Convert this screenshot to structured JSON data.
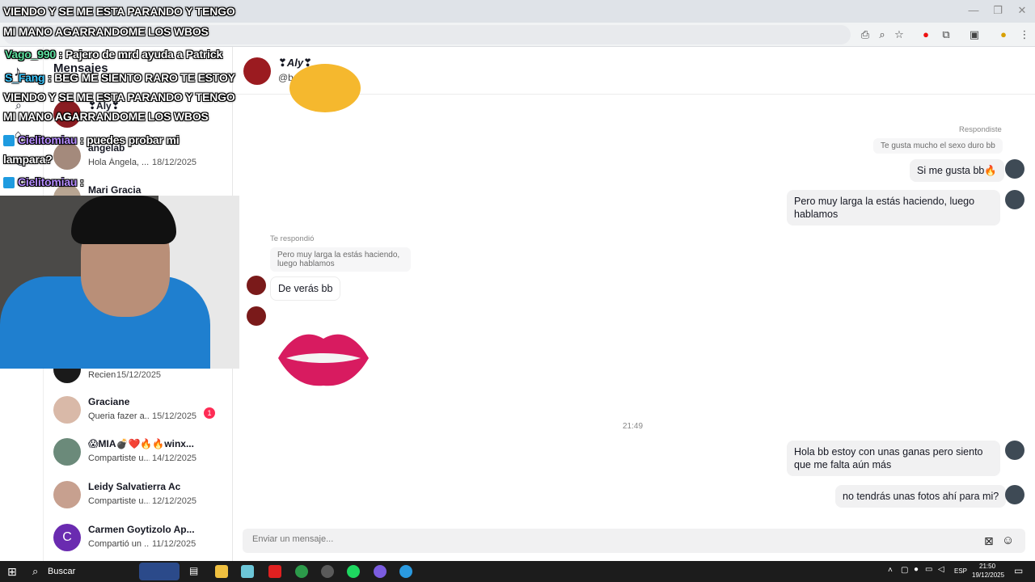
{
  "browser": {
    "window_controls": [
      "—",
      "❐",
      "✕"
    ],
    "toolbar_icons": [
      "install-icon",
      "zoom-icon",
      "star-icon",
      "opera-icon",
      "extensions-icon",
      "tab-icon",
      "profile-icon",
      "menu-icon"
    ]
  },
  "sidebar": {
    "title": "Mensajes"
  },
  "conversations": [
    {
      "name": "❣Aly❣",
      "preview": "",
      "date": ""
    },
    {
      "name": "angelab",
      "preview": "Hola Ángela, ...",
      "date": "18/12/2025"
    },
    {
      "name": "Mari Gracia",
      "preview": "",
      "date": ""
    },
    {
      "name": "",
      "preview": "Recien",
      "date": "15/12/2025"
    },
    {
      "name": "Graciane",
      "preview": "Queria fazer a...",
      "date": "15/12/2025",
      "badge": "1"
    },
    {
      "name": "😱MIA💣❤️🔥🔥winx...",
      "preview": "Compartiste u...",
      "date": "14/12/2025"
    },
    {
      "name": "Leidy Salvatierra Ac",
      "preview": "Compartiste u...",
      "date": "12/12/2025"
    },
    {
      "name": "Carmen Goytizolo Ap...",
      "preview": "Compartió un ...",
      "date": "11/12/2025",
      "initial": "C"
    }
  ],
  "chat": {
    "contact_name": "❣Aly❣",
    "contact_handle": "@baby123123",
    "messages": {
      "respondiste_label": "Respondiste",
      "quote1": "Te gusta mucho el sexo duro bb",
      "me1": "Si me gusta bb🔥",
      "me2": "Pero muy larga la estás haciendo, luego hablamos",
      "respondio_label": "Te respondió",
      "quote2": "Pero muy larga la estás haciendo, luego hablamos",
      "them1": "De verás bb",
      "time": "21:49",
      "me3": "Hola bb estoy con unas ganas pero siento que me falta aún más",
      "me4": "no tendrás unas fotos ahí para mi?"
    },
    "composer_placeholder": "Enviar un mensaje..."
  },
  "overlay": {
    "line1": "VIENDO Y SE ME ESTA PARANDO Y TENGO",
    "line2": "MI MANO AGARRANDOME LOS WBOS",
    "chat1_user": "Vago_990",
    "chat1_text": ": Pajero de mrd ayuda a Patrick",
    "chat2_user": "S_Fang",
    "chat2_text": ": BEG ME SIENTO RARO TE ESTOY",
    "line3": "VIENDO Y SE ME ESTA PARANDO Y TENGO",
    "line4": "MI MANO AGARRANDOME LOS WBOS",
    "chat3_user": "Cielitomiau",
    "chat3_text": ": puedes probar mi",
    "chat3_text2": "lampara?",
    "chat4_user": "Cielitomiau",
    "chat4_text": ":"
  },
  "taskbar": {
    "search": "Buscar",
    "lang": "ESP",
    "time": "21:50",
    "date": "19/12/2025"
  }
}
